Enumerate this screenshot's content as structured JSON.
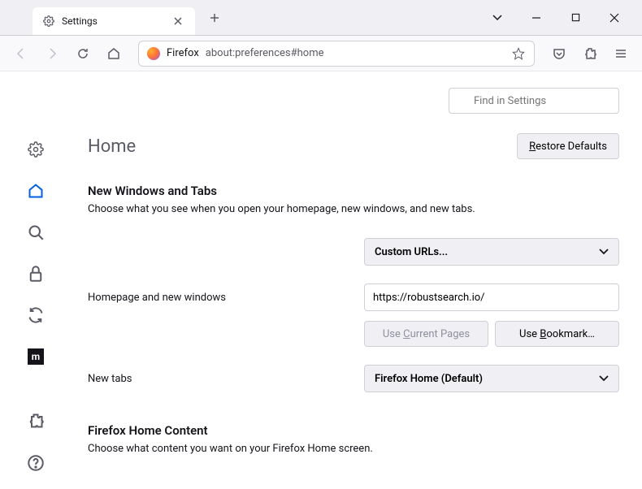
{
  "tab": {
    "title": "Settings"
  },
  "urlbar": {
    "label": "Firefox",
    "url": "about:preferences#home"
  },
  "search": {
    "placeholder": "Find in Settings"
  },
  "page": {
    "title": "Home",
    "restore_btn": "Restore Defaults",
    "restore_key": "R"
  },
  "section1": {
    "title": "New Windows and Tabs",
    "desc": "Choose what you see when you open your homepage, new windows, and new tabs.",
    "homepage_label": "Homepage and new windows",
    "homepage_select": "Custom URLs...",
    "homepage_url": "https://robustsearch.io/",
    "use_current": "Use Current Pages",
    "use_current_key": "C",
    "use_bookmark": "Use Bookmark…",
    "use_bookmark_key": "B",
    "newtabs_label": "New tabs",
    "newtabs_select": "Firefox Home (Default)"
  },
  "section2": {
    "title": "Firefox Home Content",
    "desc": "Choose what content you want on your Firefox Home screen."
  }
}
